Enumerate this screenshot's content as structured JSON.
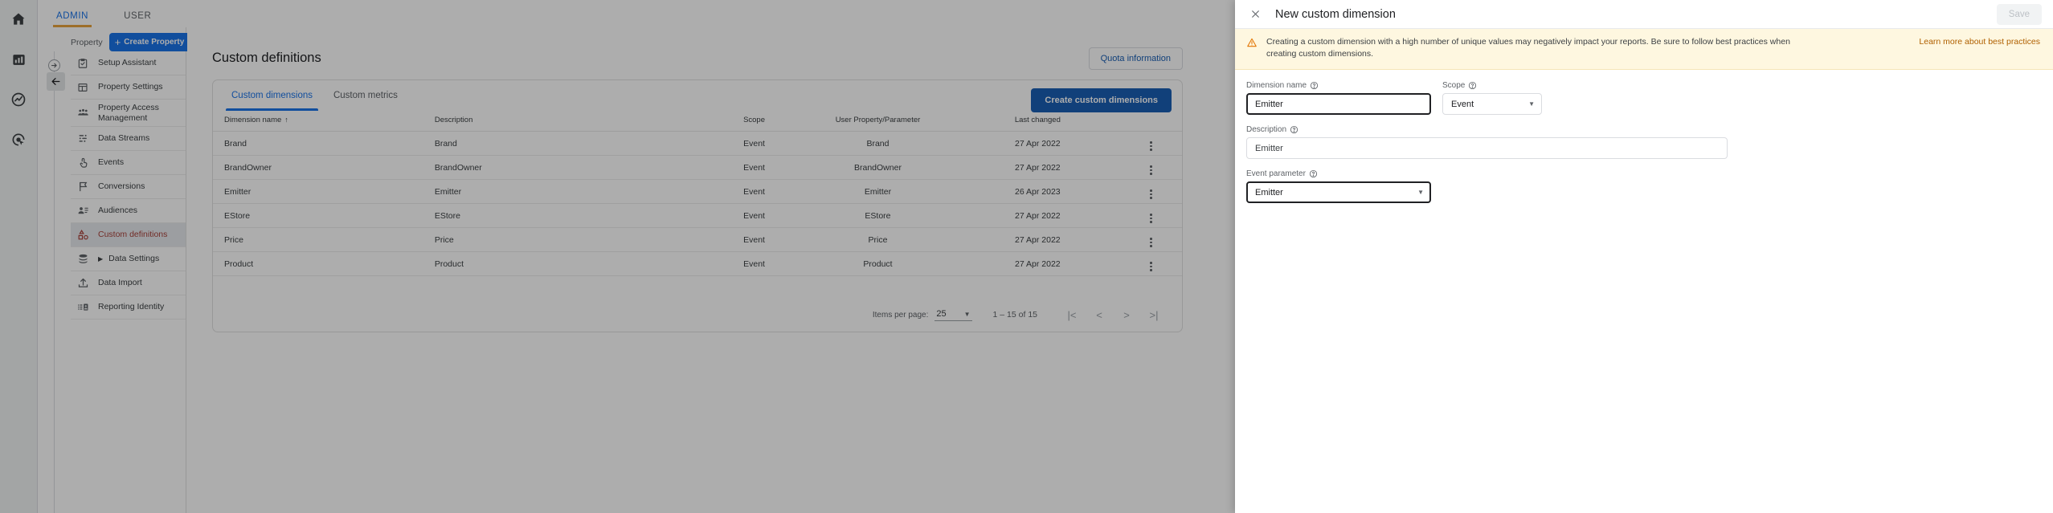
{
  "rail": {
    "items": [
      {
        "name": "home-icon",
        "label": "Home"
      },
      {
        "name": "reports-icon",
        "label": "Reports"
      },
      {
        "name": "explore-icon",
        "label": "Explore"
      },
      {
        "name": "advertising-icon",
        "label": "Advertising"
      }
    ]
  },
  "topbar": {
    "tabs": [
      {
        "label": "ADMIN",
        "active": true
      },
      {
        "label": "USER",
        "active": false
      }
    ]
  },
  "property_column": {
    "label": "Property",
    "create_button": "Create Property",
    "plus": "+",
    "back_arrow": "←",
    "forward_arrow": "→",
    "items": [
      {
        "label": "Setup Assistant",
        "icon": "clipboard-check-icon",
        "active": false
      },
      {
        "label": "Property Settings",
        "icon": "layout-icon",
        "active": false
      },
      {
        "label": "Property Access Management",
        "icon": "people-icon",
        "active": false
      },
      {
        "label": "Data Streams",
        "icon": "data-streams-icon",
        "active": false
      },
      {
        "label": "Events",
        "icon": "tap-icon",
        "active": false
      },
      {
        "label": "Conversions",
        "icon": "flag-icon",
        "active": false
      },
      {
        "label": "Audiences",
        "icon": "audience-icon",
        "active": false
      },
      {
        "label": "Custom definitions",
        "icon": "shapes-icon",
        "active": true
      },
      {
        "label": "Data Settings",
        "icon": "database-icon",
        "active": false,
        "expandable": true
      },
      {
        "label": "Data Import",
        "icon": "upload-icon",
        "active": false
      },
      {
        "label": "Reporting Identity",
        "icon": "identity-icon",
        "active": false
      }
    ]
  },
  "main": {
    "page_title": "Custom definitions",
    "quota_button": "Quota information",
    "tabs": [
      {
        "label": "Custom dimensions",
        "active": true
      },
      {
        "label": "Custom metrics",
        "active": false
      }
    ],
    "create_button": "Create custom dimensions",
    "table": {
      "columns": [
        "Dimension name",
        "Description",
        "Scope",
        "User Property/Parameter",
        "Last changed"
      ],
      "sort_indicator": "↑",
      "rows": [
        {
          "name": "Brand",
          "description": "Brand",
          "scope": "Event",
          "parameter": "Brand",
          "last_changed": "27 Apr 2022"
        },
        {
          "name": "BrandOwner",
          "description": "BrandOwner",
          "scope": "Event",
          "parameter": "BrandOwner",
          "last_changed": "27 Apr 2022"
        },
        {
          "name": "Emitter",
          "description": "Emitter",
          "scope": "Event",
          "parameter": "Emitter",
          "last_changed": "26 Apr 2023"
        },
        {
          "name": "EStore",
          "description": "EStore",
          "scope": "Event",
          "parameter": "EStore",
          "last_changed": "27 Apr 2022"
        },
        {
          "name": "Price",
          "description": "Price",
          "scope": "Event",
          "parameter": "Price",
          "last_changed": "27 Apr 2022"
        },
        {
          "name": "Product",
          "description": "Product",
          "scope": "Event",
          "parameter": "Product",
          "last_changed": "27 Apr 2022"
        }
      ]
    },
    "pagination": {
      "items_per_page_label": "Items per page:",
      "items_per_page_value": "25",
      "range": "1 – 15 of 15",
      "first": "|<",
      "prev": "<",
      "next": ">",
      "last": ">|"
    }
  },
  "panel": {
    "close_label": "×",
    "title": "New custom dimension",
    "save_label": "Save",
    "warning": {
      "text": "Creating a custom dimension with a high number of unique values may negatively impact your reports. Be sure to follow best practices when creating custom dimensions.",
      "link": "Learn more about best practices"
    },
    "fields": {
      "dimension_name": {
        "label": "Dimension name",
        "value": "Emitter"
      },
      "scope": {
        "label": "Scope",
        "value": "Event"
      },
      "description": {
        "label": "Description",
        "value": "Emitter"
      },
      "event_parameter": {
        "label": "Event parameter",
        "value": "Emitter"
      }
    },
    "help_glyph": "?"
  },
  "colors": {
    "brand_blue": "#1a73e8",
    "button_blue": "#1a5fb4",
    "active_nav": "#a8423a",
    "tab_underline_admin": "#e8a33d",
    "warning_bg": "#fef7e0",
    "warning_link": "#b06000"
  }
}
